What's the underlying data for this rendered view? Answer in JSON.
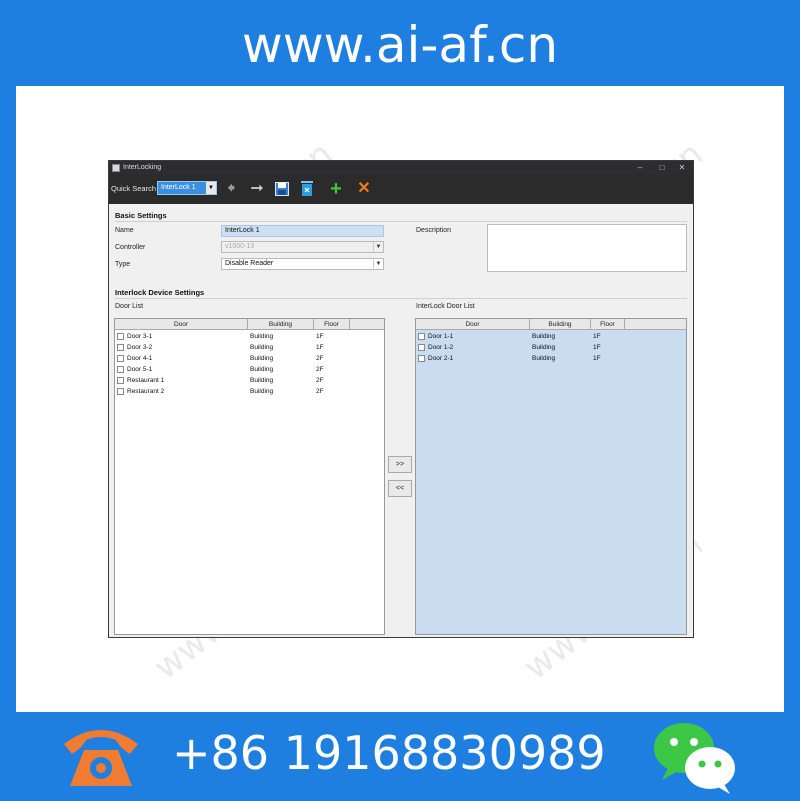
{
  "banner": {
    "site": "www.ai-af.cn",
    "phone": "+86 19168830989",
    "phone_icon": "phone-icon",
    "wechat_icon": "wechat-icon",
    "watermark": "www.ai-af.cn"
  },
  "window": {
    "title": "InterLocking",
    "controls": [
      "–",
      "□",
      "✕"
    ]
  },
  "toolbar": {
    "quick_search_label": "Quick Search",
    "quick_search_value": "InterLock 1",
    "icons": [
      "back-arrow-icon",
      "forward-arrow-icon",
      "save-icon",
      "delete-icon",
      "add-icon",
      "close-icon"
    ]
  },
  "basic": {
    "title": "Basic Settings",
    "name_label": "Name",
    "name_value": "InterLock 1",
    "controller_label": "Controller",
    "controller_value": "v1000-13",
    "type_label": "Type",
    "type_value": "Disable Reader",
    "description_label": "Description",
    "description_value": ""
  },
  "device": {
    "title": "Interlock Device Settings",
    "door_list_label": "Door List",
    "interlock_list_label": "InterLock Door List",
    "columns": [
      "Door",
      "Building",
      "Floor"
    ],
    "door_list": [
      {
        "door": "Door 3-1",
        "building": "Building",
        "floor": "1F"
      },
      {
        "door": "Door 3-2",
        "building": "Building",
        "floor": "1F"
      },
      {
        "door": "Door 4-1",
        "building": "Building",
        "floor": "2F"
      },
      {
        "door": "Door 5-1",
        "building": "Building",
        "floor": "2F"
      },
      {
        "door": "Restaurant 1",
        "building": "Building",
        "floor": "2F"
      },
      {
        "door": "Restaurant 2",
        "building": "Building",
        "floor": "2F"
      }
    ],
    "interlock_list": [
      {
        "door": "Door 1-1",
        "building": "Building",
        "floor": "1F"
      },
      {
        "door": "Door 1-2",
        "building": "Building",
        "floor": "1F"
      },
      {
        "door": "Door 2-1",
        "building": "Building",
        "floor": "1F"
      }
    ],
    "add_button": ">>",
    "remove_button": "<<"
  },
  "colors": {
    "brand_blue": "#1e7fe0",
    "selected_blue": "#c9dcf0",
    "toolbar_dark": "#2b2b2b",
    "add_green": "#3cc83c",
    "delete_orange": "#f07c1e",
    "phone_orange": "#f07c32",
    "wechat_green": "#3cc846"
  }
}
